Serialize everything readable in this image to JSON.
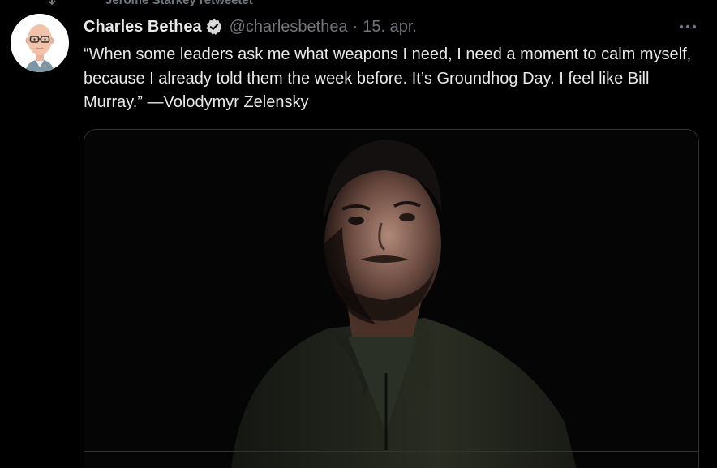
{
  "retweet": {
    "icon": "retweet-icon",
    "text": "Jerome Starkey retweetet"
  },
  "author": {
    "display_name": "Charles Bethea",
    "handle": "@charlesbethea",
    "separator": "·",
    "date": "15. apr.",
    "verified_icon": "verified-badge-icon",
    "avatar_icon": "cartoon-avatar"
  },
  "tweet": {
    "text": "“When some leaders ask me what weapons I need, I need a moment to calm myself, because I already told them the week before. It’s Groundhog Day. I feel like Bill Murray.” —Volodymyr Zelensky"
  },
  "menu": {
    "icon": "more-icon"
  },
  "media": {
    "type": "photo"
  },
  "colors": {
    "background": "#000000",
    "text_primary": "#e7e9ea",
    "text_secondary": "#71767b",
    "border": "#2f3336"
  }
}
